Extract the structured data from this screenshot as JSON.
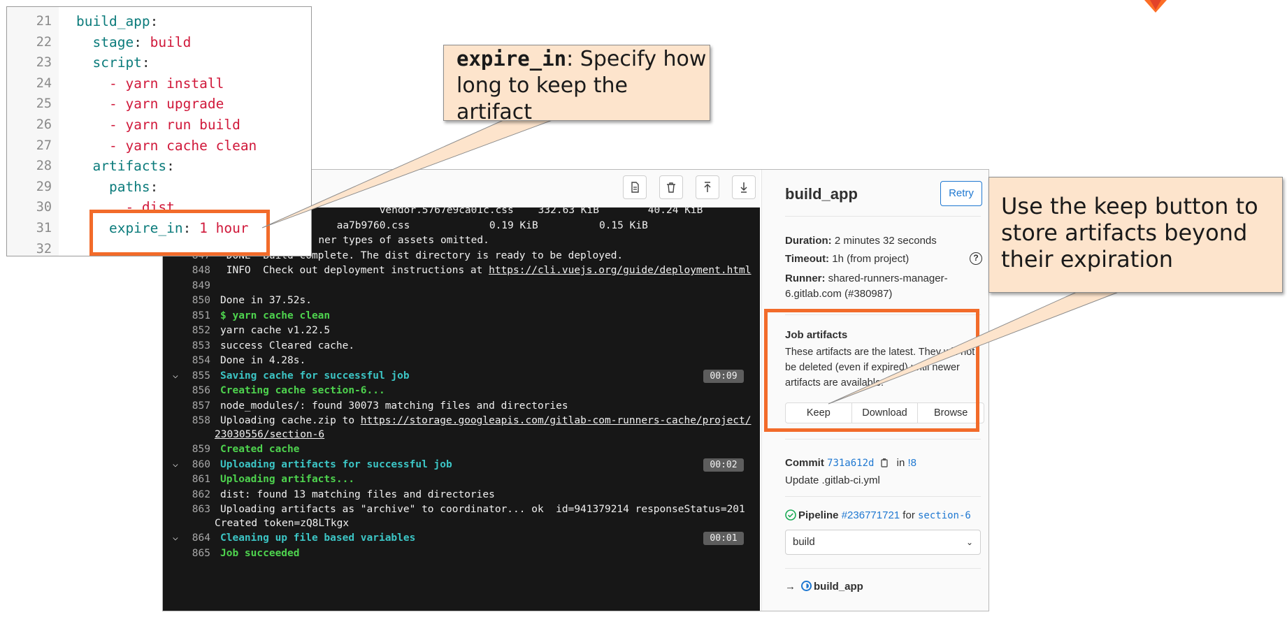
{
  "colors": {
    "accent": "#f26b2a",
    "callout_bg": "#fde4cc",
    "link": "#1f78d1",
    "log_bg": "#171717",
    "log_green": "#4ed34e",
    "log_cyan": "#3cc5c5"
  },
  "code": {
    "lines": [
      {
        "num": "21",
        "key": "build_app",
        "sep": ":",
        "val": ""
      },
      {
        "num": "22",
        "key": "  stage",
        "sep": ": ",
        "val": "build"
      },
      {
        "num": "23",
        "key": "  script",
        "sep": ":",
        "val": ""
      },
      {
        "num": "24",
        "key": "",
        "sep": "    - ",
        "val": "yarn install"
      },
      {
        "num": "25",
        "key": "",
        "sep": "    - ",
        "val": "yarn upgrade"
      },
      {
        "num": "26",
        "key": "",
        "sep": "    - ",
        "val": "yarn run build"
      },
      {
        "num": "27",
        "key": "",
        "sep": "    - ",
        "val": "yarn cache clean"
      },
      {
        "num": "28",
        "key": "  artifacts",
        "sep": ":",
        "val": ""
      },
      {
        "num": "29",
        "key": "    paths",
        "sep": ":",
        "val": ""
      },
      {
        "num": "30",
        "key": "",
        "sep": "      - ",
        "val": "dist"
      },
      {
        "num": "31",
        "key": "    expire_in",
        "sep": ": ",
        "val": "1 hour"
      },
      {
        "num": "32",
        "key": "",
        "sep": "",
        "val": ""
      }
    ]
  },
  "callouts": {
    "expire": {
      "code": "expire_in",
      "text": ": Specify how long to keep the artifact"
    },
    "keep": {
      "text": "Use the keep button to store artifacts beyond their expiration"
    }
  },
  "log": {
    "toolbar_icons": [
      "raw-log-icon",
      "erase-log-icon",
      "scroll-top-icon",
      "scroll-bottom-icon"
    ],
    "partial": [
      {
        "text": "                           vendor.5767e9ca01c.css    332.63 KiB        40.24 KiB"
      },
      {
        "text": "                    aa7b9760.css             0.19 KiB          0.15 KiB"
      },
      {
        "text": "                 ner types of assets omitted."
      }
    ],
    "lines": [
      {
        "num": "847",
        "text": " DONE  Build complete. The dist directory is ready to be deployed."
      },
      {
        "num": "848",
        "text": " INFO  Check out deployment instructions at ",
        "link": "https://cli.vuejs.org/guide/deployment.html"
      },
      {
        "num": "849",
        "text": ""
      },
      {
        "num": "850",
        "text": "Done in 37.52s."
      },
      {
        "num": "851",
        "text": "$ yarn cache clean",
        "style": "g"
      },
      {
        "num": "852",
        "text": "yarn cache v1.22.5"
      },
      {
        "num": "853",
        "text": "success Cleared cache."
      },
      {
        "num": "854",
        "text": "Done in 4.28s."
      },
      {
        "num": "855",
        "text": "Saving cache for successful job",
        "style": "c",
        "section": true,
        "duration": "00:09"
      },
      {
        "num": "856",
        "text": "Creating cache section-6...",
        "style": "g"
      },
      {
        "num": "857",
        "text": "node_modules/: found 30073 matching files and directories"
      },
      {
        "num": "858",
        "text": "Uploading cache.zip to ",
        "link": "https://storage.googleapis.com/gitlab-com-runners-cache/project/",
        "cont_link": "23030556/section-6"
      },
      {
        "num": "859",
        "text": "Created cache",
        "style": "g"
      },
      {
        "num": "860",
        "text": "Uploading artifacts for successful job",
        "style": "c",
        "section": true,
        "duration": "00:02"
      },
      {
        "num": "861",
        "text": "Uploading artifacts...",
        "style": "g"
      },
      {
        "num": "862",
        "text": "dist: found 13 matching files and directories"
      },
      {
        "num": "863",
        "text": "Uploading artifacts as \"archive\" to coordinator... ok  id=941379214 responseStatus=201",
        "cont": "Created token=zQ8LTkgx"
      },
      {
        "num": "864",
        "text": "Cleaning up file based variables",
        "style": "c",
        "section": true,
        "duration": "00:01"
      },
      {
        "num": "865",
        "text": "Job succeeded",
        "style": "g"
      }
    ]
  },
  "sidebar": {
    "title": "build_app",
    "retry_label": "Retry",
    "duration_label": "Duration:",
    "duration_value": " 2 minutes 32 seconds",
    "timeout_label": "Timeout:",
    "timeout_value": " 1h (from project)",
    "runner_label": "Runner:",
    "runner_value": " shared-runners-manager-6.gitlab.com (#380987)",
    "help_glyph": "?",
    "artifacts_title": "Job artifacts",
    "artifacts_desc": "These artifacts are the latest. They will not be deleted (even if expired) until newer artifacts are available.",
    "keep_label": "Keep",
    "download_label": "Download",
    "browse_label": "Browse",
    "commit_label": "Commit",
    "commit_sha": "731a612d",
    "commit_in": " in ",
    "commit_mr": "!8",
    "commit_message": "Update .gitlab-ci.yml",
    "pipeline_label": "Pipeline",
    "pipeline_id": "#236771721",
    "pipeline_for": " for ",
    "pipeline_branch": "section-6",
    "stage_select": "build",
    "job_arrow": "→",
    "job_name": "build_app"
  }
}
